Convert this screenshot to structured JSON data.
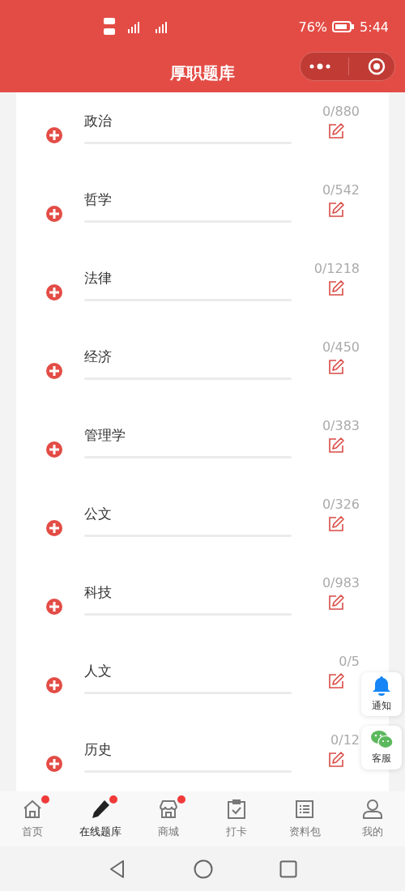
{
  "status_bar": {
    "battery": "76%",
    "time": "5:44"
  },
  "header": {
    "title": "厚职题库"
  },
  "subjects": [
    {
      "name": "政治",
      "count": "0/880",
      "level": 0
    },
    {
      "name": "哲学",
      "count": "0/542",
      "level": 0
    },
    {
      "name": "法律",
      "count": "0/1218",
      "level": 0
    },
    {
      "name": "经济",
      "count": "0/450",
      "level": 0
    },
    {
      "name": "管理学",
      "count": "0/383",
      "level": 0
    },
    {
      "name": "公文",
      "count": "0/326",
      "level": 0
    },
    {
      "name": "科技",
      "count": "0/983",
      "level": 0
    },
    {
      "name": "人文",
      "count": "0/5",
      "level": 0
    },
    {
      "name": "历史",
      "count": "0/12",
      "level": 0
    }
  ],
  "floating_buttons": [
    {
      "kind": "bell",
      "label": "通知"
    },
    {
      "kind": "chat",
      "label": "客服"
    }
  ],
  "tabs": [
    {
      "kind": "home",
      "label": "首页",
      "selected": false,
      "badge": true
    },
    {
      "kind": "pencil",
      "label": "在线题库",
      "selected": true,
      "badge": true
    },
    {
      "kind": "shop",
      "label": "商城",
      "selected": false,
      "badge": true
    },
    {
      "kind": "clipboard",
      "label": "打卡",
      "selected": false,
      "badge": false
    },
    {
      "kind": "list",
      "label": "资料包",
      "selected": false,
      "badge": false
    },
    {
      "kind": "person",
      "label": "我的",
      "selected": false,
      "badge": false
    }
  ]
}
